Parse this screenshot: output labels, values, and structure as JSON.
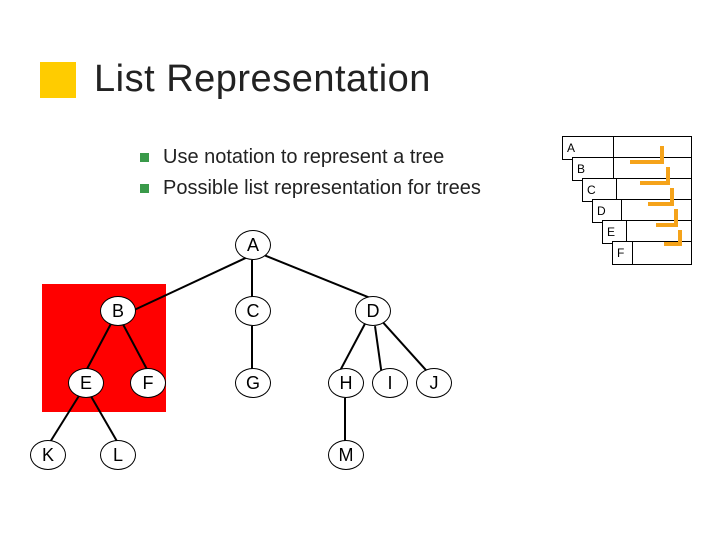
{
  "title": "List Representation",
  "bullets": {
    "b1": "Use notation to represent a tree",
    "b2": "Possible list representation for trees"
  },
  "stack": {
    "r0": "A",
    "r1": "B",
    "r2": "C",
    "r3": "D",
    "r4": "E",
    "r5": "F"
  },
  "tree": {
    "A": "A",
    "B": "B",
    "C": "C",
    "D": "D",
    "E": "E",
    "F": "F",
    "G": "G",
    "H": "H",
    "I": "I",
    "J": "J",
    "K": "K",
    "L": "L",
    "M": "M"
  }
}
